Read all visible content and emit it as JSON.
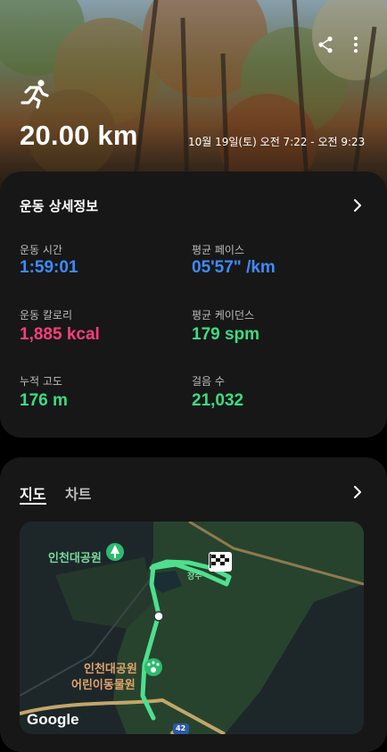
{
  "hero": {
    "distance": "20.00 km",
    "datetime": "10월 19일(토) 오전 7:22 - 오전 9:23",
    "icons": {
      "share": "share-icon",
      "more": "more-vert-icon",
      "activity": "running-icon"
    }
  },
  "details": {
    "title": "운동 상세정보",
    "stats": [
      {
        "label": "운동 시간",
        "value": "1:59:01",
        "color": "#3d8bff"
      },
      {
        "label": "평균 페이스",
        "value": "05'57\" /km",
        "color": "#3d8bff"
      },
      {
        "label": "운동 칼로리",
        "value": "1,885 kcal",
        "color": "#ff3d7f"
      },
      {
        "label": "평균 케이던스",
        "value": "179 spm",
        "color": "#3ddc84"
      },
      {
        "label": "누적 고도",
        "value": "176 m",
        "color": "#3ddc84"
      },
      {
        "label": "걸음 수",
        "value": "21,032",
        "color": "#3ddc84"
      }
    ]
  },
  "map_card": {
    "tabs": [
      "지도",
      "차트"
    ],
    "active_tab": "지도",
    "map": {
      "labels": [
        "인천대공원",
        "인천대공원",
        "어린이동물원",
        "장수"
      ],
      "road_number": "42",
      "attribution": "Google"
    }
  }
}
